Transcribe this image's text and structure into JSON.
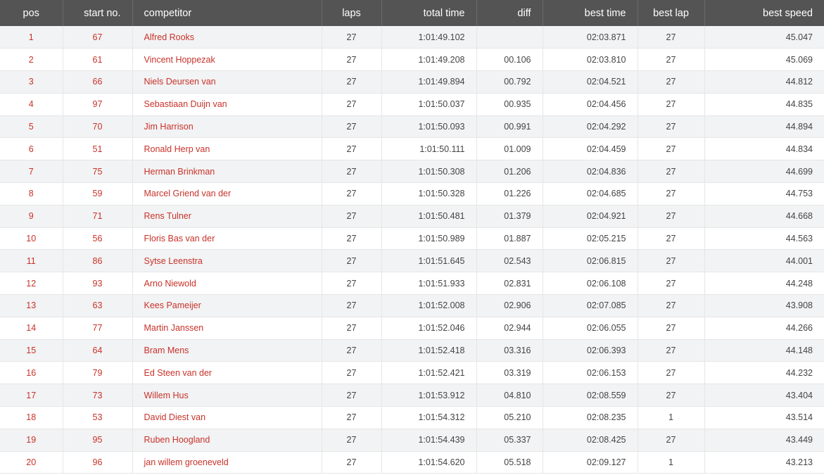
{
  "columns": {
    "pos": "pos",
    "start_no": "start no.",
    "competitor": "competitor",
    "laps": "laps",
    "total_time": "total time",
    "diff": "diff",
    "best_time": "best time",
    "best_lap": "best lap",
    "best_speed": "best speed"
  },
  "colors": {
    "header_bg": "#545454",
    "link_red": "#c8322a",
    "row_alt": "#f2f3f4"
  },
  "rows": [
    {
      "pos": "1",
      "start_no": "67",
      "competitor": "Alfred Rooks",
      "laps": "27",
      "total_time": "1:01:49.102",
      "diff": "",
      "best_time": "02:03.871",
      "best_lap": "27",
      "best_speed": "45.047"
    },
    {
      "pos": "2",
      "start_no": "61",
      "competitor": "Vincent Hoppezak",
      "laps": "27",
      "total_time": "1:01:49.208",
      "diff": "00.106",
      "best_time": "02:03.810",
      "best_lap": "27",
      "best_speed": "45.069"
    },
    {
      "pos": "3",
      "start_no": "66",
      "competitor": "Niels Deursen van",
      "laps": "27",
      "total_time": "1:01:49.894",
      "diff": "00.792",
      "best_time": "02:04.521",
      "best_lap": "27",
      "best_speed": "44.812"
    },
    {
      "pos": "4",
      "start_no": "97",
      "competitor": "Sebastiaan Duijn van",
      "laps": "27",
      "total_time": "1:01:50.037",
      "diff": "00.935",
      "best_time": "02:04.456",
      "best_lap": "27",
      "best_speed": "44.835"
    },
    {
      "pos": "5",
      "start_no": "70",
      "competitor": "Jim Harrison",
      "laps": "27",
      "total_time": "1:01:50.093",
      "diff": "00.991",
      "best_time": "02:04.292",
      "best_lap": "27",
      "best_speed": "44.894"
    },
    {
      "pos": "6",
      "start_no": "51",
      "competitor": "Ronald Herp van",
      "laps": "27",
      "total_time": "1:01:50.111",
      "diff": "01.009",
      "best_time": "02:04.459",
      "best_lap": "27",
      "best_speed": "44.834"
    },
    {
      "pos": "7",
      "start_no": "75",
      "competitor": "Herman Brinkman",
      "laps": "27",
      "total_time": "1:01:50.308",
      "diff": "01.206",
      "best_time": "02:04.836",
      "best_lap": "27",
      "best_speed": "44.699"
    },
    {
      "pos": "8",
      "start_no": "59",
      "competitor": "Marcel Griend van der",
      "laps": "27",
      "total_time": "1:01:50.328",
      "diff": "01.226",
      "best_time": "02:04.685",
      "best_lap": "27",
      "best_speed": "44.753"
    },
    {
      "pos": "9",
      "start_no": "71",
      "competitor": "Rens Tulner",
      "laps": "27",
      "total_time": "1:01:50.481",
      "diff": "01.379",
      "best_time": "02:04.921",
      "best_lap": "27",
      "best_speed": "44.668"
    },
    {
      "pos": "10",
      "start_no": "56",
      "competitor": "Floris Bas van der",
      "laps": "27",
      "total_time": "1:01:50.989",
      "diff": "01.887",
      "best_time": "02:05.215",
      "best_lap": "27",
      "best_speed": "44.563"
    },
    {
      "pos": "11",
      "start_no": "86",
      "competitor": "Sytse Leenstra",
      "laps": "27",
      "total_time": "1:01:51.645",
      "diff": "02.543",
      "best_time": "02:06.815",
      "best_lap": "27",
      "best_speed": "44.001"
    },
    {
      "pos": "12",
      "start_no": "93",
      "competitor": "Arno Niewold",
      "laps": "27",
      "total_time": "1:01:51.933",
      "diff": "02.831",
      "best_time": "02:06.108",
      "best_lap": "27",
      "best_speed": "44.248"
    },
    {
      "pos": "13",
      "start_no": "63",
      "competitor": "Kees Pameijer",
      "laps": "27",
      "total_time": "1:01:52.008",
      "diff": "02.906",
      "best_time": "02:07.085",
      "best_lap": "27",
      "best_speed": "43.908"
    },
    {
      "pos": "14",
      "start_no": "77",
      "competitor": "Martin Janssen",
      "laps": "27",
      "total_time": "1:01:52.046",
      "diff": "02.944",
      "best_time": "02:06.055",
      "best_lap": "27",
      "best_speed": "44.266"
    },
    {
      "pos": "15",
      "start_no": "64",
      "competitor": "Bram Mens",
      "laps": "27",
      "total_time": "1:01:52.418",
      "diff": "03.316",
      "best_time": "02:06.393",
      "best_lap": "27",
      "best_speed": "44.148"
    },
    {
      "pos": "16",
      "start_no": "79",
      "competitor": "Ed Steen van der",
      "laps": "27",
      "total_time": "1:01:52.421",
      "diff": "03.319",
      "best_time": "02:06.153",
      "best_lap": "27",
      "best_speed": "44.232"
    },
    {
      "pos": "17",
      "start_no": "73",
      "competitor": "Willem Hus",
      "laps": "27",
      "total_time": "1:01:53.912",
      "diff": "04.810",
      "best_time": "02:08.559",
      "best_lap": "27",
      "best_speed": "43.404"
    },
    {
      "pos": "18",
      "start_no": "53",
      "competitor": "David Diest van",
      "laps": "27",
      "total_time": "1:01:54.312",
      "diff": "05.210",
      "best_time": "02:08.235",
      "best_lap": "1",
      "best_speed": "43.514"
    },
    {
      "pos": "19",
      "start_no": "95",
      "competitor": "Ruben Hoogland",
      "laps": "27",
      "total_time": "1:01:54.439",
      "diff": "05.337",
      "best_time": "02:08.425",
      "best_lap": "27",
      "best_speed": "43.449"
    },
    {
      "pos": "20",
      "start_no": "96",
      "competitor": "jan willem groeneveld",
      "laps": "27",
      "total_time": "1:01:54.620",
      "diff": "05.518",
      "best_time": "02:09.127",
      "best_lap": "1",
      "best_speed": "43.213"
    }
  ]
}
